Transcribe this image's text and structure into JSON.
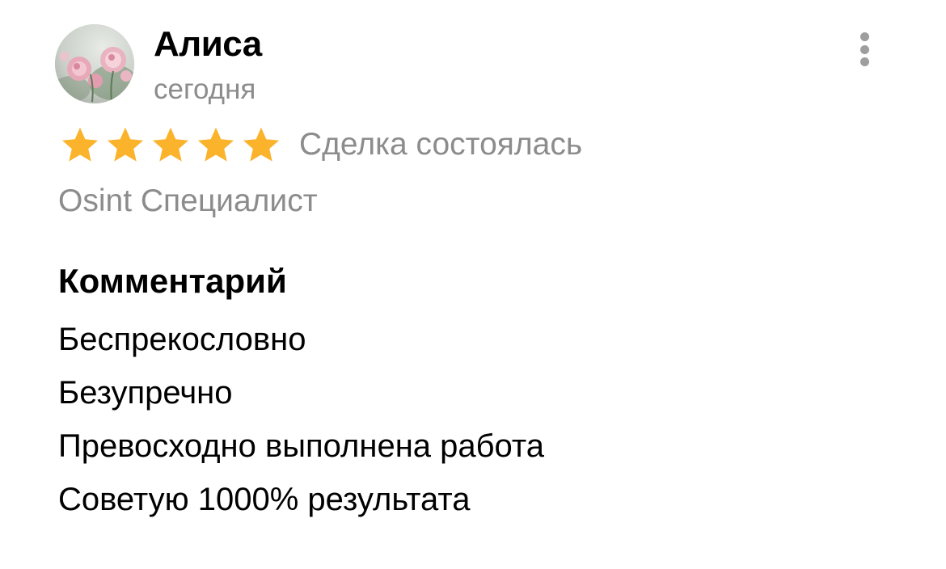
{
  "review": {
    "author_name": "Алиса",
    "date": "сегодня",
    "avatar_icon": "flower-photo-avatar",
    "menu_icon": "more-vertical-icon",
    "rating": {
      "value": 5,
      "max": 5,
      "star_color": "#FBB32B",
      "star_icon": "star-icon"
    },
    "deal_status": "Сделка состоялась",
    "service": "Osint Специалист",
    "comment": {
      "heading": "Комментарий",
      "lines": [
        "Беспрекословно",
        "Безупречно",
        "Превосходно выполнена работа",
        "Советую 1000% результата"
      ]
    }
  },
  "colors": {
    "primary_text": "#000000",
    "secondary_text": "#8C8C8C",
    "menu_dots": "#9E9E9E"
  }
}
